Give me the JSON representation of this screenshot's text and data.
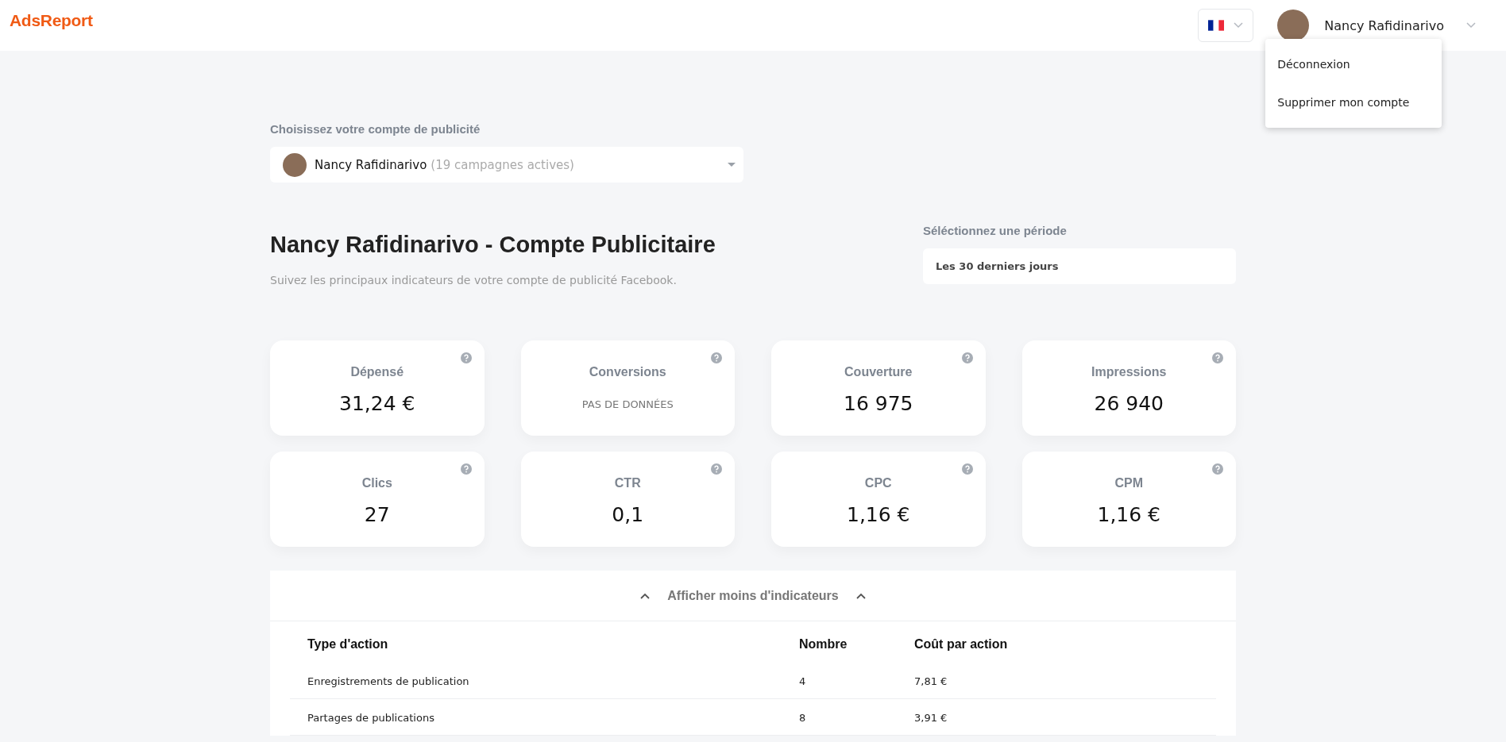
{
  "header": {
    "logo": "AdsReport",
    "user": {
      "name": "Nancy Rafidinarivo",
      "menu_open": true
    }
  },
  "user_menu": [
    "Déconnexion",
    "Supprimer mon compte"
  ],
  "account_picker": {
    "label": "Choisissez votre compte de publicité",
    "name": "Nancy Rafidinarivo",
    "detail": "(19 campagnes actives)"
  },
  "title": "Nancy Rafidinarivo - Compte Publicitaire",
  "subtitle": "Suivez les principaux indicateurs de votre compte de publicité Facebook.",
  "period": {
    "label": "Séléctionnez une période",
    "value": "Les 30 derniers jours"
  },
  "metrics": [
    {
      "label": "Dépensé",
      "value": "31,24 €",
      "kind": "value"
    },
    {
      "label": "Conversions",
      "value": "PAS DE DONNÉES",
      "kind": "empty"
    },
    {
      "label": "Couverture",
      "value": "16 975",
      "kind": "value"
    },
    {
      "label": "Impressions",
      "value": "26 940",
      "kind": "value"
    },
    {
      "label": "Clics",
      "value": "27",
      "kind": "value"
    },
    {
      "label": "CTR",
      "value": "0,1",
      "kind": "value"
    },
    {
      "label": "CPC",
      "value": "1,16 €",
      "kind": "value"
    },
    {
      "label": "CPM",
      "value": "1,16 €",
      "kind": "value"
    }
  ],
  "toggle": {
    "label": "Afficher moins d'indicateurs",
    "expanded": true
  },
  "table": {
    "columns": [
      "Type d'action",
      "Nombre",
      "Coût par action"
    ],
    "rows": [
      [
        "Enregistrements de publication",
        "4",
        "7,81 €"
      ],
      [
        "Partages de publications",
        "8",
        "3,91 €"
      ]
    ]
  }
}
